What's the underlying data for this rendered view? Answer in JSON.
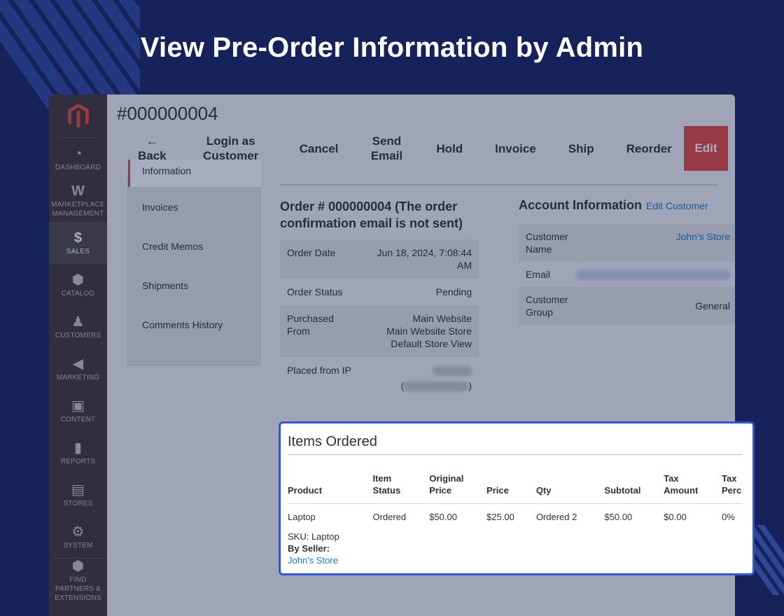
{
  "headline": "View Pre-Order Information by Admin",
  "colors": {
    "background": "#15235a",
    "sidebar": "#41362f",
    "accent": "#e5473a",
    "link": "#1979c3",
    "highlight_border": "#3553d8"
  },
  "sidebar": {
    "items": [
      {
        "label": "DASHBOARD",
        "icon": "speedometer-icon"
      },
      {
        "label": "MARKETPLACE MANAGEMENT",
        "icon": "marketplace-icon"
      },
      {
        "label": "SALES",
        "icon": "dollar-icon"
      },
      {
        "label": "CATALOG",
        "icon": "cube-icon"
      },
      {
        "label": "CUSTOMERS",
        "icon": "person-icon"
      },
      {
        "label": "MARKETING",
        "icon": "megaphone-icon"
      },
      {
        "label": "CONTENT",
        "icon": "layout-icon"
      },
      {
        "label": "REPORTS",
        "icon": "bar-chart-icon"
      },
      {
        "label": "STORES",
        "icon": "storefront-icon"
      },
      {
        "label": "SYSTEM",
        "icon": "gear-icon"
      },
      {
        "label": "FIND PARTNERS & EXTENSIONS",
        "icon": "box-icon"
      }
    ]
  },
  "order": {
    "title": "#000000004",
    "actions": {
      "back": "Back",
      "back_arrow": "←",
      "login_as_customer": "Login as Customer",
      "cancel": "Cancel",
      "send_email": "Send Email",
      "hold": "Hold",
      "invoice": "Invoice",
      "ship": "Ship",
      "reorder": "Reorder",
      "edit": "Edit"
    }
  },
  "tabs": {
    "cut_label": "Information",
    "items": [
      "Invoices",
      "Credit Memos",
      "Shipments",
      "Comments History"
    ]
  },
  "order_info": {
    "title": "Order # 000000004 (The order confirmation email is not sent)",
    "rows": [
      {
        "label": "Order Date",
        "value": "Jun 18, 2024, 7:08:44 AM"
      },
      {
        "label": "Order Status",
        "value": "Pending"
      },
      {
        "label": "Purchased From",
        "value_lines": [
          "Main Website",
          "Main Website Store",
          "Default Store View"
        ]
      },
      {
        "label": "Placed from IP",
        "value": ""
      }
    ]
  },
  "account_info": {
    "title": "Account Information",
    "edit_link": "Edit Customer",
    "rows": [
      {
        "label": "Customer Name",
        "value": "John's Store"
      },
      {
        "label": "Email",
        "value": ""
      },
      {
        "label": "Customer Group",
        "value": "General"
      }
    ]
  },
  "items_ordered": {
    "title": "Items Ordered",
    "columns": [
      "Product",
      "Item Status",
      "Original Price",
      "Price",
      "Qty",
      "Subtotal",
      "Tax Amount",
      "Tax Perc"
    ],
    "rows": [
      {
        "product": "Laptop",
        "sku": "SKU: Laptop",
        "by_seller_label": "By Seller:",
        "seller": "John's Store",
        "item_status": "Ordered",
        "original_price": "$50.00",
        "price": "$25.00",
        "qty": "Ordered 2",
        "subtotal": "$50.00",
        "tax_amount": "$0.00",
        "tax_percent": "0%"
      }
    ]
  }
}
